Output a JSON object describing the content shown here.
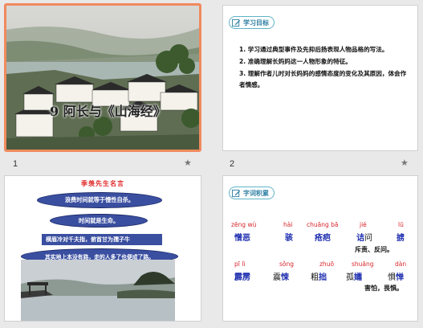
{
  "slides": [
    {
      "number": "1",
      "title": "9  阿长与《山海经》"
    },
    {
      "number": "2",
      "badge": "学习目标",
      "goals": [
        "1. 学习通过典型事件及先抑后扬表现人物品格的写法。",
        "2. 准确理解长妈妈这一人物形象的特征。",
        "3. 理解作者儿时对长妈妈的感情态度的变化及其原因，体会作者情感。"
      ]
    },
    {
      "title": "季羡先生名言",
      "quotes": [
        "浪费时间就等于慢性自杀。",
        "时间就是生命。",
        "横眉冷对千夫指，俯首甘为孺子牛",
        "其实地上本没有路，走的人多了也便成了路。"
      ]
    },
    {
      "badge": "字词积累",
      "row1": [
        {
          "pinyin": "zēng wù",
          "word": "憎恶"
        },
        {
          "pinyin": "hài",
          "word": "骇"
        },
        {
          "pinyin": "chuāng bā",
          "word": "疮疤"
        },
        {
          "pinyin": "jié",
          "word_main": "诘",
          "word_post": "问"
        },
        {
          "pinyin": "lū",
          "word": "掳"
        }
      ],
      "row1_meaning": "斥责、反问。",
      "row2": [
        {
          "pinyin": "pī lì",
          "word": "霹雳"
        },
        {
          "pinyin": "sǒng",
          "word_pre": "震",
          "word_main": "悚"
        },
        {
          "pinyin": "zhuō",
          "word_pre": "粗",
          "word_main": "拙"
        },
        {
          "pinyin": "shuāng",
          "word_pre": "孤",
          "word_main": "孀"
        },
        {
          "pinyin": "dàn",
          "word_pre": "惧",
          "word_main": "惮"
        }
      ],
      "row2_meaning": "害怕，畏惧。"
    }
  ],
  "thumbnail_labels": {
    "slide1": "1",
    "slide2": "2"
  },
  "star_icon": "★"
}
